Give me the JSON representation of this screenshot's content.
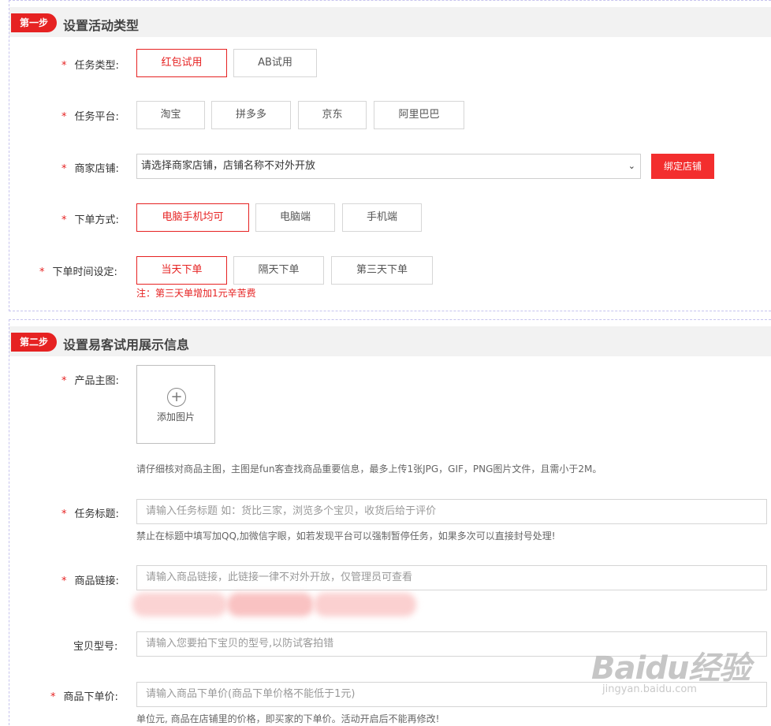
{
  "step1": {
    "badge": "第一步",
    "title": "设置活动类型",
    "task_type": {
      "label": "任务类型:",
      "options": [
        "红包试用",
        "AB试用"
      ],
      "selected": "红包试用"
    },
    "platform": {
      "label": "任务平台:",
      "options": [
        "淘宝",
        "拼多多",
        "京东",
        "阿里巴巴"
      ]
    },
    "shop": {
      "label": "商家店铺:",
      "select_value": "请选择商家店铺，店铺名称不对外开放",
      "bind_button": "绑定店铺"
    },
    "order_method": {
      "label": "下单方式:",
      "options": [
        "电脑手机均可",
        "电脑端",
        "手机端"
      ],
      "selected": "电脑手机均可"
    },
    "order_time": {
      "label": "下单时间设定:",
      "options": [
        "当天下单",
        "隔天下单",
        "第三天下单"
      ],
      "selected": "当天下单",
      "note": "注：第三天单增加1元辛苦费"
    }
  },
  "step2": {
    "badge": "第二步",
    "title": "设置易客试用展示信息",
    "main_image": {
      "label": "产品主图:",
      "add_label": "添加图片",
      "hint": "请仔细核对商品主图，主图是fun客查找商品重要信息，最多上传1张JPG，GIF，PNG图片文件，且需小于2M。"
    },
    "task_title": {
      "label": "任务标题:",
      "placeholder": "请输入任务标题 如：货比三家，浏览多个宝贝，收货后给于评价",
      "hint": "禁止在标题中填写加QQ,加微信字眼，如若发现平台可以强制暂停任务，如果多次可以直接封号处理!"
    },
    "product_link": {
      "label": "商品链接:",
      "placeholder": "请输入商品链接，此链接一律不对外开放，仅管理员可查看"
    },
    "model": {
      "label": "宝贝型号:",
      "placeholder": "请输入您要拍下宝贝的型号,以防试客拍错"
    },
    "price": {
      "label": "商品下单价:",
      "placeholder": "请输入商品下单价(商品下单价格不能低于1元)",
      "hint": "单位元, 商品在店铺里的价格，即买家的下单价。活动开启后不能再修改!"
    }
  },
  "watermark": {
    "main": "Baidu经验",
    "sub": "jingyan.baidu.com"
  },
  "colors": {
    "accent": "#e62222",
    "button": "#f32e2e",
    "header_bg": "#f2f2f2",
    "border_dashed": "#c6c3ee"
  },
  "icons": {
    "plus": "plus-circle-icon",
    "select": "chevron-down-icon"
  }
}
